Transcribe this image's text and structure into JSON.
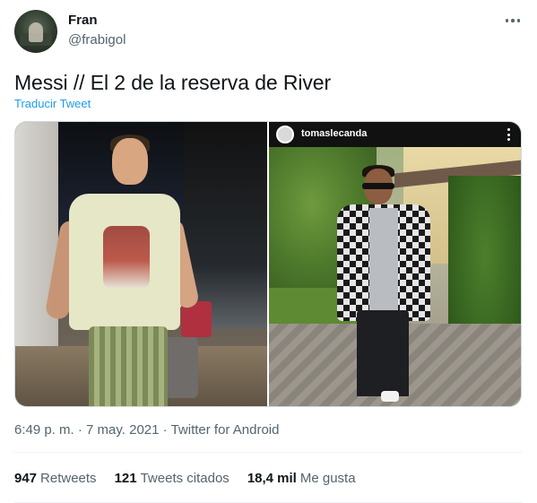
{
  "tweet": {
    "author": {
      "name": "Fran",
      "handle": "@frabigol"
    },
    "text": "Messi // El 2 de la reserva de River",
    "translate_label": "Traducir Tweet",
    "media": {
      "right_overlay_username": "tomaslecanda"
    },
    "timestamp": {
      "time": "6:49 p. m.",
      "separator": "·",
      "date": "7 may. 2021",
      "source": "Twitter for Android"
    },
    "stats": {
      "retweets": {
        "count": "947",
        "label": "Retweets"
      },
      "quotes": {
        "count": "121",
        "label": "Tweets citados"
      },
      "likes": {
        "count": "18,4 mil",
        "label": "Me gusta"
      }
    }
  },
  "colors": {
    "text_primary": "#0f1419",
    "text_secondary": "#536471",
    "accent": "#1d9bf0",
    "divider": "#eff3f4"
  },
  "icons": {
    "more": "more-horizontal-icon",
    "overlay_more": "more-vertical-icon"
  }
}
